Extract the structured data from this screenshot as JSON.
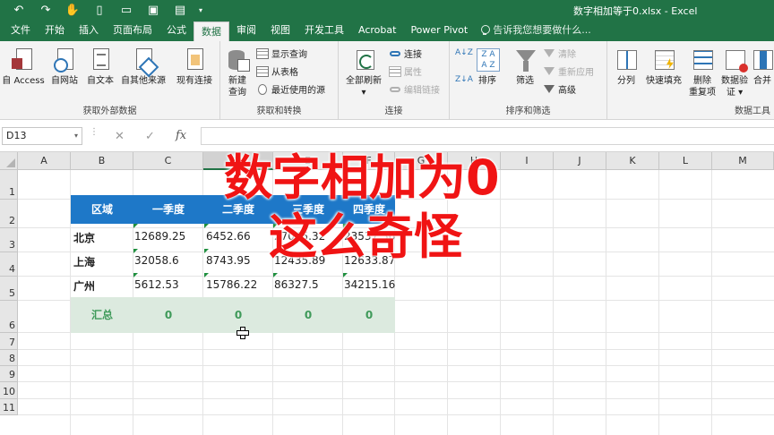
{
  "window": {
    "title": "数字相加等于0.xlsx - Excel"
  },
  "quick_access": [
    {
      "name": "undo-icon",
      "glyph": "↶"
    },
    {
      "name": "redo-icon",
      "glyph": "↷"
    },
    {
      "name": "touch-mode-icon",
      "glyph": "✋"
    },
    {
      "name": "new-file-icon",
      "glyph": "▯"
    },
    {
      "name": "open-folder-icon",
      "glyph": "▭"
    },
    {
      "name": "save-icon",
      "glyph": "▣"
    },
    {
      "name": "print-preview-icon",
      "glyph": "▤"
    },
    {
      "name": "customize-qat-icon",
      "glyph": "▾"
    }
  ],
  "tabs": [
    "文件",
    "开始",
    "插入",
    "页面布局",
    "公式",
    "数据",
    "审阅",
    "视图",
    "开发工具",
    "Acrobat",
    "Power Pivot"
  ],
  "active_tab": "数据",
  "tell_me": "告诉我您想要做什么...",
  "ribbon": {
    "get_external": {
      "label": "获取外部数据",
      "buttons": [
        "自 Access",
        "自网站",
        "自文本",
        "自其他来源",
        "现有连接"
      ]
    },
    "get_transform": {
      "label": "获取和转换",
      "new_query": [
        "新建",
        "查询"
      ],
      "show_query": "显示查询",
      "from_table": "从表格",
      "recent_sources": "最近使用的源"
    },
    "connections": {
      "label": "连接",
      "refresh_all": "全部刷新",
      "connections": "连接",
      "properties": "属性",
      "edit_links": "编辑链接"
    },
    "sort_filter": {
      "label": "排序和筛选",
      "sort": "排序",
      "filter": "筛选",
      "clear": "清除",
      "reapply": "重新应用",
      "advanced": "高级"
    },
    "data_tools": {
      "label": "数据工具",
      "text_to_columns": "分列",
      "flash_fill": "快速填充",
      "remove_dup": [
        "删除",
        "重复项"
      ],
      "validation": [
        "数据验",
        "证 ▾"
      ],
      "consolidate": "合并"
    }
  },
  "formula_bar": {
    "name_box": "D13",
    "cancel": "✕",
    "enter": "✓",
    "fx": "fx",
    "value": ""
  },
  "columns": [
    "A",
    "B",
    "C",
    "D",
    "E",
    "F",
    "G",
    "H",
    "I",
    "J",
    "K",
    "L",
    "M"
  ],
  "rows": [
    "1",
    "2",
    "3",
    "4",
    "5",
    "6",
    "7",
    "8",
    "9",
    "10",
    "11"
  ],
  "table": {
    "headers": [
      "区域",
      "一季度",
      "二季度",
      "三季度",
      "四季度"
    ],
    "rows": [
      [
        "北京",
        "12689.25",
        "6452.66",
        "27045.32",
        "23537.36"
      ],
      [
        "上海",
        "32058.6",
        "8743.95",
        "12435.89",
        "12633.87"
      ],
      [
        "广州",
        "5612.53",
        "15786.22",
        "86327.5",
        "34215.16"
      ]
    ],
    "total_label": "汇总",
    "totals": [
      "0",
      "0",
      "0",
      "0"
    ]
  },
  "overlay": {
    "line1": "数字相加为0",
    "line2": "这么奇怪"
  },
  "colors": {
    "excel_green": "#217346",
    "header_blue": "#1e78c8",
    "total_fill": "#dceadf",
    "total_text": "#3f9a5a",
    "caption_red": "#f01414"
  }
}
